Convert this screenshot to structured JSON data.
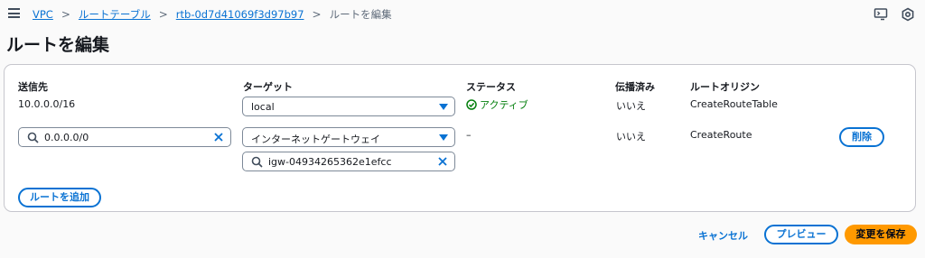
{
  "breadcrumb": {
    "items": [
      "VPC",
      "ルートテーブル",
      "rtb-0d7d41069f3d97b97"
    ],
    "current": "ルートを編集",
    "separator": ">"
  },
  "page": {
    "title": "ルートを編集"
  },
  "table": {
    "headers": {
      "destination": "送信先",
      "target": "ターゲット",
      "status": "ステータス",
      "propagated": "伝播済み",
      "origin": "ルートオリジン"
    },
    "rows": [
      {
        "destination": "10.0.0.0/16",
        "target_select": "local",
        "status": "アクティブ",
        "propagated": "いいえ",
        "origin": "CreateRouteTable"
      },
      {
        "destination_input": "0.0.0.0/0",
        "target_select": "インターネットゲートウェイ",
        "target_input": "igw-04934265362e1efcc",
        "status": "–",
        "propagated": "いいえ",
        "origin": "CreateRoute",
        "remove_label": "削除"
      }
    ],
    "add_route_label": "ルートを追加"
  },
  "footer": {
    "cancel_label": "キャンセル",
    "preview_label": "プレビュー",
    "save_label": "変更を保存"
  },
  "icons": {
    "menu": "hamburger-menu-icon",
    "cloudshell": "cloudshell-icon",
    "settings": "settings-icon",
    "status_ok": "check-circle-icon",
    "search": "search-icon",
    "clear": "close-icon",
    "dropdown": "caret-down-icon"
  },
  "colors": {
    "link": "#0972d3",
    "success": "#037f0c",
    "primary_button": "#ff9900"
  }
}
